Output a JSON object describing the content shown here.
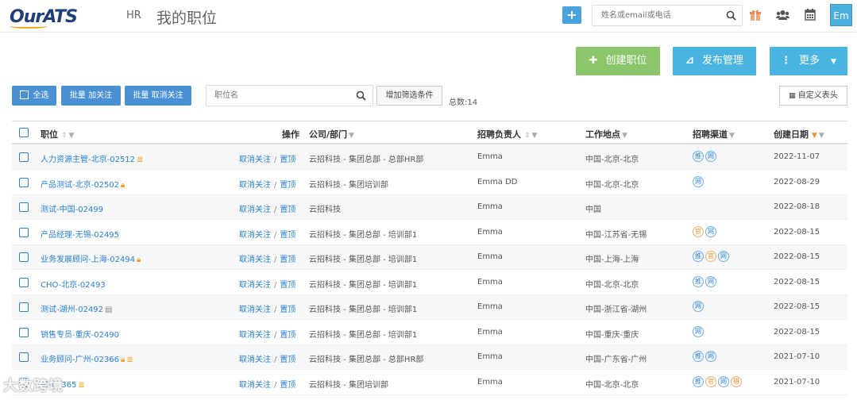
{
  "header": {
    "logo_text": "OurATS",
    "nav_hr": "HR",
    "page_title": "我的职位",
    "add_label": "+",
    "search_placeholder": "姓名或email或电话",
    "avatar_text": "Em"
  },
  "toolbar": {
    "create_label": "创建职位",
    "publish_label": "发布管理",
    "more_label": "更多",
    "select_all_label": "全选",
    "batch_follow_label": "批量 加关注",
    "batch_unfollow_label": "批量 取消关注",
    "position_search_placeholder": "职位名",
    "add_filter_label": "增加筛选条件",
    "total_label": "总数:14",
    "custom_header_label": "自定义表头"
  },
  "table": {
    "headers": {
      "title": "职位",
      "ops": "操作",
      "dept": "公司/部门",
      "owner": "招聘负责人",
      "location": "工作地点",
      "channel": "招聘渠道",
      "created": "创建日期"
    },
    "op_unfollow": "取消关注",
    "op_pin": "置顶",
    "op_sep": "/",
    "rows": [
      {
        "title": "人力资源主管-北京-02512",
        "mark": "db",
        "dept": "云招科技 - 集团总部 - 总部HR部",
        "owner": "Emma",
        "location": "中国-北京-北京",
        "channels": [
          "推",
          "网"
        ],
        "date": "2022-11-07"
      },
      {
        "title": "产品测试-北京-02502",
        "mark": "lock",
        "dept": "云招科技 - 集团培训部",
        "owner": "Emma DD",
        "location": "中国-北京-北京",
        "channels": [
          "网"
        ],
        "date": "2022-08-29"
      },
      {
        "title": "测试-中国-02499",
        "mark": "",
        "dept": "云招科技",
        "owner": "Emma",
        "location": "中国",
        "channels": [],
        "date": "2022-08-18"
      },
      {
        "title": "产品经理-无锡-02495",
        "mark": "",
        "dept": "云招科技 - 集团总部 - 培训部1",
        "owner": "Emma",
        "location": "中国-江苏省-无锡",
        "channels": [
          "官",
          "网"
        ],
        "date": "2022-08-15"
      },
      {
        "title": "业务发展顾问-上海-02494",
        "mark": "lock",
        "dept": "云招科技 - 集团总部 - 培训部1",
        "owner": "Emma",
        "location": "中国-上海-上海",
        "channels": [
          "推",
          "官",
          "网"
        ],
        "date": "2022-08-15"
      },
      {
        "title": "CHO-北京-02493",
        "mark": "",
        "dept": "云招科技 - 集团总部 - 培训部1",
        "owner": "Emma",
        "location": "中国-北京-北京",
        "channels": [
          "推",
          "网"
        ],
        "date": "2022-08-15"
      },
      {
        "title": "测试-湖州-02492",
        "mark": "flag",
        "dept": "云招科技 - 集团总部 - 培训部1",
        "owner": "Emma",
        "location": "中国-浙江省-湖州",
        "channels": [
          "网"
        ],
        "date": "2022-08-15"
      },
      {
        "title": "销售专员-重庆-02490",
        "mark": "",
        "dept": "云招科技 - 集团总部 - 培训部1",
        "owner": "Emma",
        "location": "中国-重庆-重庆",
        "channels": [
          "网"
        ],
        "date": "2022-08-15"
      },
      {
        "title": "业务顾问-广州-02366",
        "mark": "lockdb",
        "dept": "云招科技 - 集团总部 - 总部HR部",
        "owner": "Emma",
        "location": "中国-广东省-广州",
        "channels": [
          "推",
          "网"
        ],
        "date": "2021-07-10"
      },
      {
        "title": "京-02365",
        "mark": "db",
        "dept": "云招科技 - 集团培训部",
        "owner": "Emma",
        "location": "中国-北京-北京",
        "channels": [
          "推",
          "官",
          "网",
          "猎"
        ],
        "date": "2021-07-10"
      }
    ]
  },
  "watermark": "大数跨境",
  "colors": {
    "green": "#8cc66b",
    "cyan": "#4ab4e0",
    "blue": "#4a90d4",
    "link": "#2a7fcf",
    "orange": "#f0a020"
  }
}
